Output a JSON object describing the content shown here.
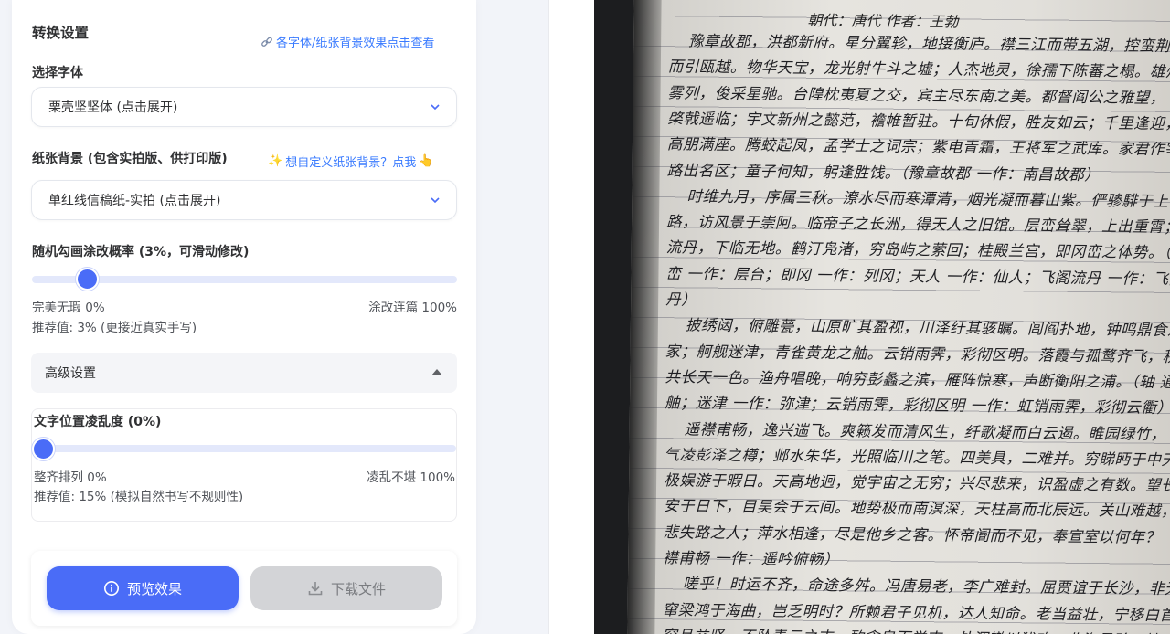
{
  "settings": {
    "title": "转换设置",
    "font_preview_link": "各字体/纸张背景效果点击查看",
    "font_label": "选择字体",
    "font_value": "栗壳坚坚体 (点击展开)",
    "paper_label": "纸张背景 (包含实拍版、供打印版)",
    "paper_custom_link": "想自定义纸张背景？点我",
    "paper_value": "单红线信稿纸-实拍 (点击展开)",
    "strike_label": "随机勾画涂改概率 (3%，可滑动修改)",
    "strike_value": 3,
    "strike_min_label": "完美无瑕 0%",
    "strike_max_label": "涂改连篇 100%",
    "strike_recommend": "推荐值: 3% (更接近真实手写)",
    "advanced_label": "高级设置",
    "jitter_label": "文字位置凌乱度 (0%)",
    "jitter_value": 0,
    "jitter_min_label": "整齐排列 0%",
    "jitter_max_label": "凌乱不堪 100%",
    "jitter_recommend": "推荐值: 15% (模拟自然书写不规则性)"
  },
  "actions": {
    "preview_label": "预览效果",
    "download_label": "下载文件"
  },
  "preview": {
    "title_line": "朝代：唐代 作者：王勃",
    "lines": [
      "豫章故郡，洪都新府。星分翼轸，地接衡庐。襟三江而带五湖，控蛮荆",
      "而引瓯越。物华天宝，龙光射牛斗之墟；人杰地灵，徐孺下陈蕃之榻。雄州",
      "雾列，俊采星驰。台隍枕夷夏之交，宾主尽东南之美。都督阎公之雅望，",
      "棨戟遥临；宇文新州之懿范，襜帷暂驻。十旬休假，胜友如云；千里逢迎，",
      "高朋满座。腾蛟起凤，孟学士之词宗；紫电青霜，王将军之武库。家君作宰，",
      "路出名区；童子何知，躬逢胜饯。（豫章故郡 一作：南昌故郡）",
      "时维九月，序属三秋。潦水尽而寒潭清，烟光凝而暮山紫。俨骖騑于上",
      "路，访风景于崇阿。临帝子之长洲，得天人之旧馆。层峦耸翠，上出重霄；飞阁",
      "流丹，下临无地。鹤汀凫渚，穷岛屿之萦回；桂殿兰宫，即冈峦之体势。（层",
      "峦 一作：层台；即冈 一作：列冈；天人 一作：仙人；飞阁流丹 一作：飞阁翔",
      "丹）",
      "披绣闼，俯雕甍，山原旷其盈视，川泽纡其骇瞩。闾阎扑地，钟鸣鼎食之",
      "家；舸舰迷津，青雀黄龙之舳。云销雨霁，彩彻区明。落霞与孤鹜齐飞，秋水",
      "共长天一色。渔舟唱晚，响穷彭蠡之滨，雁阵惊寒，声断衡阳之浦。（轴 通：",
      "舳；迷津 一作：弥津；云销雨霁，彩彻区明 一作：虹销雨霁，彩彻云衢）",
      "遥襟甫畅，逸兴遄飞。爽籁发而清风生，纤歌凝而白云遏。睢园绿竹，",
      "气凌彭泽之樽；邺水朱华，光照临川之笔。四美具，二难并。穷睇眄于中天，",
      "极娱游于暇日。天高地迥，觉宇宙之无穷；兴尽悲来，识盈虚之有数。望长",
      "安于日下，目吴会于云间。地势极而南溟深，天柱高而北辰远。关山难越，谁",
      "悲失路之人；萍水相逢，尽是他乡之客。怀帝阍而不见，奉宣室以何年？（遥",
      "襟甫畅 一作：遥吟俯畅）",
      "嗟乎！时运不齐，命途多舛。冯唐易老，李广难封。屈贾谊于长沙，非无圣主；",
      "窜梁鸿于海曲，岂乏明时？所赖君子见机，达人知命。老当益壮，宁移白首之心？",
      "穷且益坚，不坠青云之志。酌贪泉而觉爽，处涸辙以犹欢。北海虽赊，扶"
    ]
  }
}
